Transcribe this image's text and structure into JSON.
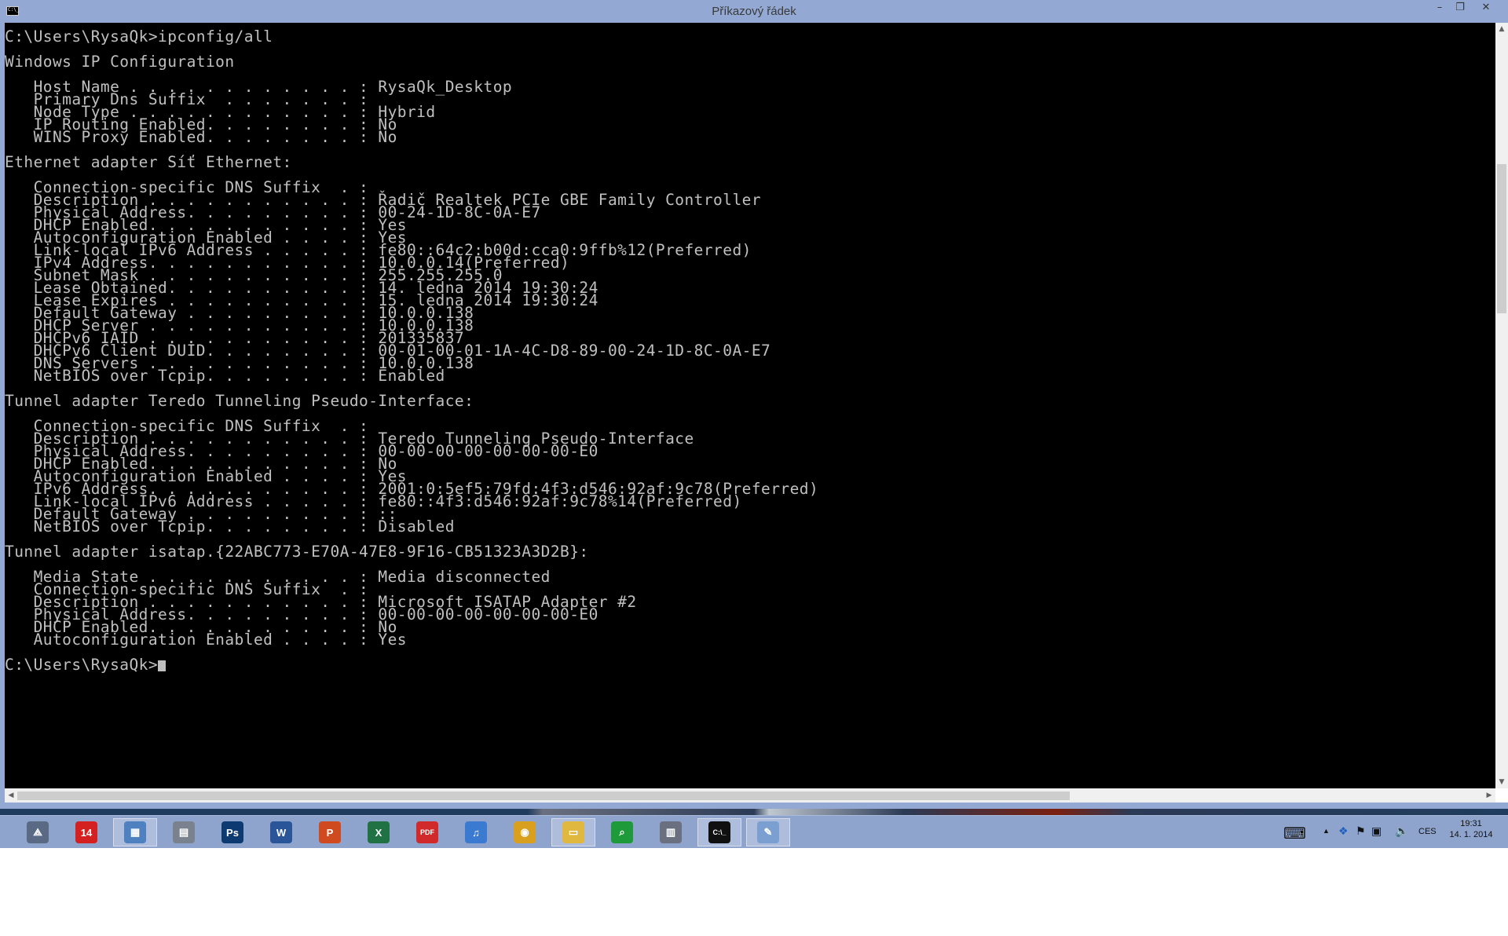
{
  "window": {
    "title": "Příkazový řádek",
    "controls": {
      "minimize": "–",
      "restore": "❐",
      "close": "✕"
    }
  },
  "console": {
    "lines": [
      "C:\\Users\\RysaQk>ipconfig/all",
      "",
      "Windows IP Configuration",
      "",
      "   Host Name . . . . . . . . . . . . : RysaQk_Desktop",
      "   Primary Dns Suffix  . . . . . . . : ",
      "   Node Type . . . . . . . . . . . . : Hybrid",
      "   IP Routing Enabled. . . . . . . . : No",
      "   WINS Proxy Enabled. . . . . . . . : No",
      "",
      "Ethernet adapter Síť Ethernet:",
      "",
      "   Connection-specific DNS Suffix  . : ",
      "   Description . . . . . . . . . . . : Řadič Realtek PCIe GBE Family Controller",
      "   Physical Address. . . . . . . . . : 00-24-1D-8C-0A-E7",
      "   DHCP Enabled. . . . . . . . . . . : Yes",
      "   Autoconfiguration Enabled . . . . : Yes",
      "   Link-local IPv6 Address . . . . . : fe80::64c2:b00d:cca0:9ffb%12(Preferred)",
      "   IPv4 Address. . . . . . . . . . . : 10.0.0.14(Preferred)",
      "   Subnet Mask . . . . . . . . . . . : 255.255.255.0",
      "   Lease Obtained. . . . . . . . . . : 14. ledna 2014 19:30:24",
      "   Lease Expires . . . . . . . . . . : 15. ledna 2014 19:30:24",
      "   Default Gateway . . . . . . . . . : 10.0.0.138",
      "   DHCP Server . . . . . . . . . . . : 10.0.0.138",
      "   DHCPv6 IAID . . . . . . . . . . . : 201335837",
      "   DHCPv6 Client DUID. . . . . . . . : 00-01-00-01-1A-4C-D8-89-00-24-1D-8C-0A-E7",
      "   DNS Servers . . . . . . . . . . . : 10.0.0.138",
      "   NetBIOS over Tcpip. . . . . . . . : Enabled",
      "",
      "Tunnel adapter Teredo Tunneling Pseudo-Interface:",
      "",
      "   Connection-specific DNS Suffix  . : ",
      "   Description . . . . . . . . . . . : Teredo Tunneling Pseudo-Interface",
      "   Physical Address. . . . . . . . . : 00-00-00-00-00-00-00-E0",
      "   DHCP Enabled. . . . . . . . . . . : No",
      "   Autoconfiguration Enabled . . . . : Yes",
      "   IPv6 Address. . . . . . . . . . . : 2001:0:5ef5:79fd:4f3:d546:92af:9c78(Preferred)",
      "   Link-local IPv6 Address . . . . . : fe80::4f3:d546:92af:9c78%14(Preferred)",
      "   Default Gateway . . . . . . . . . : ::",
      "   NetBIOS over Tcpip. . . . . . . . : Disabled",
      "",
      "Tunnel adapter isatap.{22ABC773-E70A-47E8-9F16-CB51323A3D2B}:",
      "",
      "   Media State . . . . . . . . . . . : Media disconnected",
      "   Connection-specific DNS Suffix  . : ",
      "   Description . . . . . . . . . . . : Microsoft ISATAP Adapter #2",
      "   Physical Address. . . . . . . . . : 00-00-00-00-00-00-00-E0",
      "   DHCP Enabled. . . . . . . . . . . : No",
      "   Autoconfiguration Enabled . . . . : Yes",
      ""
    ],
    "prompt": "C:\\Users\\RysaQk>"
  },
  "scrollbars": {
    "up_arrow": "▲",
    "down_arrow": "▼",
    "left_arrow": "◀",
    "right_arrow": "▶"
  },
  "taskbar": {
    "items": [
      {
        "name": "app-launcher",
        "glyph": "⟁",
        "color": "#5a6a85"
      },
      {
        "name": "calendar-14",
        "glyph": "14",
        "color": "#d42020"
      },
      {
        "name": "control-panel",
        "glyph": "▦",
        "color": "#4f80c0"
      },
      {
        "name": "printer",
        "glyph": "▤",
        "color": "#7a8290"
      },
      {
        "name": "photoshop",
        "glyph": "Ps",
        "color": "#0d3a70"
      },
      {
        "name": "word",
        "glyph": "W",
        "color": "#2a5699"
      },
      {
        "name": "powerpoint",
        "glyph": "P",
        "color": "#d04a20"
      },
      {
        "name": "excel",
        "glyph": "X",
        "color": "#207245"
      },
      {
        "name": "pdf",
        "glyph": "PDF",
        "color": "#d02a2a"
      },
      {
        "name": "itunes",
        "glyph": "♫",
        "color": "#3a7ad0"
      },
      {
        "name": "chrome",
        "glyph": "◉",
        "color": "#d9a020"
      },
      {
        "name": "file-explorer",
        "glyph": "▭",
        "color": "#e0b840"
      },
      {
        "name": "search-app",
        "glyph": "⌕",
        "color": "#1f9a3a"
      },
      {
        "name": "storage",
        "glyph": "▥",
        "color": "#6a7080"
      },
      {
        "name": "command-prompt",
        "glyph": "C:\\_",
        "color": "#101010"
      },
      {
        "name": "paint",
        "glyph": "✎",
        "color": "#7a9fd0"
      }
    ],
    "tray": {
      "keyboard": "⌨",
      "language": "CES",
      "time": "19:31",
      "date": "14. 1. 2014"
    }
  }
}
